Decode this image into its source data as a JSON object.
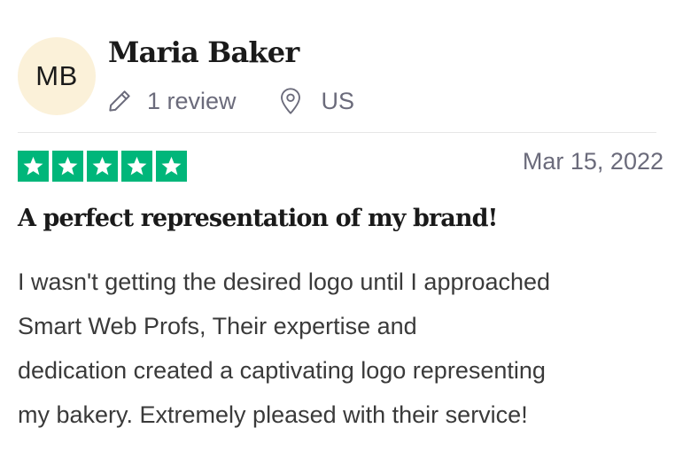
{
  "reviewer": {
    "initials": "MB",
    "name": "Maria Baker",
    "reviews": "1 review",
    "country": "US",
    "avatar_color": "#fbf1d9"
  },
  "rating": {
    "stars": 5,
    "max_stars": 5,
    "color": "#00b67a"
  },
  "review": {
    "date": "Mar 15, 2022",
    "title": "A perfect representation of my brand!",
    "body_lines": [
      "I wasn't getting the desired logo until I approached",
      "Smart Web Profs, Their expertise and",
      "dedication created a captivating logo representing",
      "my bakery. Extremely pleased with their service!"
    ]
  },
  "icons": {
    "reviews_icon": "pencil-icon",
    "country_icon": "location-pin-icon",
    "star_icon": "star-icon"
  }
}
